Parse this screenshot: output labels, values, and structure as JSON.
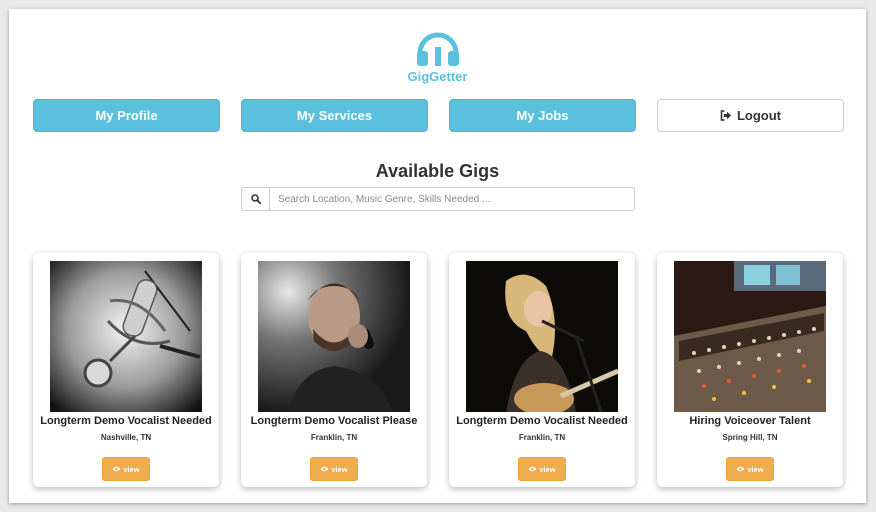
{
  "app": {
    "name": "GigGetter",
    "logo_icon": "headphones-icon",
    "brand_color": "#5bc0de"
  },
  "nav": {
    "profile_label": "My Profile",
    "services_label": "My Services",
    "jobs_label": "My Jobs",
    "logout_label": "Logout",
    "logout_icon": "sign-out-icon"
  },
  "main": {
    "heading": "Available Gigs",
    "search": {
      "icon": "search-icon",
      "placeholder": "Search Location, Music Genre, Skills Needed ..."
    }
  },
  "gigs": [
    {
      "title": "Longterm Demo Vocalist Needed",
      "location": "Nashville, TN",
      "view_label": "view",
      "image": "studio-microphone-photo"
    },
    {
      "title": "Longterm Demo Vocalist Please",
      "location": "Franklin, TN",
      "view_label": "view",
      "image": "male-singer-photo"
    },
    {
      "title": "Longterm Demo Vocalist Needed",
      "location": "Franklin, TN",
      "view_label": "view",
      "image": "female-guitarist-singer-photo"
    },
    {
      "title": "Hiring Voiceover Talent",
      "location": "Spring Hill, TN",
      "view_label": "view",
      "image": "mixing-console-photo"
    }
  ],
  "colors": {
    "primary": "#5bc0de",
    "warning": "#f0ad4e"
  }
}
